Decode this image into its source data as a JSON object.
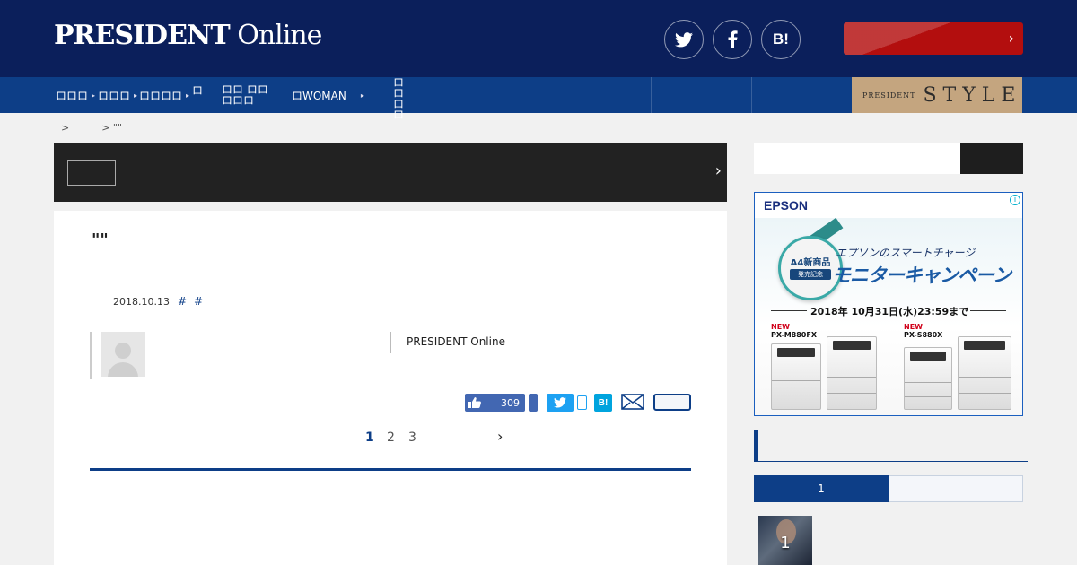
{
  "header": {
    "logo_bold": "PRESIDENT",
    "logo_light": " Online",
    "social": [
      {
        "icon": "twitter-icon"
      },
      {
        "icon": "facebook-icon"
      },
      {
        "icon": "hatena-bookmark-icon",
        "label": "B!"
      }
    ],
    "red_button_chevron": "›"
  },
  "nav": {
    "items": [
      {
        "label": "ロロロ",
        "caret": "▸"
      },
      {
        "label": "ロロロ",
        "caret": "▸"
      },
      {
        "label": "ロロロロ",
        "caret": "▸"
      },
      {
        "label": "ロ"
      },
      {
        "label": "ロロ ロロロロロ",
        "caret": "▸"
      },
      {
        "label": "ロWOMAN",
        "caret": "▸"
      },
      {
        "label": "ロロ ロロ"
      }
    ],
    "style_logo_small": "PRESIDENT",
    "style_logo_big": "STYLE"
  },
  "breadcrumb": {
    "items": [
      ">",
      "> \"\""
    ]
  },
  "banner": {
    "chevron": "›"
  },
  "article": {
    "title": "\"\"",
    "date": "2018.10.13",
    "tags": [
      "#",
      "#"
    ],
    "source": "PRESIDENT Online",
    "like_count": "309",
    "hatena_label": "B!",
    "pager": [
      "1",
      "2",
      "3"
    ],
    "pager_active": "1",
    "pager_next": "›"
  },
  "ad": {
    "brand": "EPSON",
    "info": "i",
    "badge_line1": "A4新商品",
    "badge_line2": "発売記念",
    "line1": "エプソンのスマートチャージ",
    "line2": "モニターキャンペーン",
    "deadline": "2018年 10月31日(水)23:59まで",
    "new1": "NEW",
    "model1": "PX-M880FX",
    "new2": "NEW",
    "model2": "PX-S880X"
  },
  "ranking": {
    "active_tab": "1",
    "thumb_rank": "1"
  }
}
